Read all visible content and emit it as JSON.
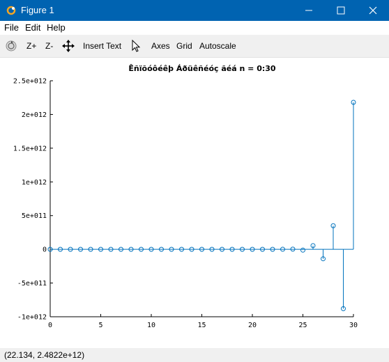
{
  "window": {
    "title": "Figure 1",
    "accent": "#0063b1"
  },
  "menu": {
    "items": [
      "File",
      "Edit",
      "Help"
    ]
  },
  "toolbar": {
    "zoom_in": "Z+",
    "zoom_out": "Z-",
    "insert_text": "Insert Text",
    "axes": "Axes",
    "grid": "Grid",
    "autoscale": "Autoscale"
  },
  "status": {
    "coords": "(22.134, 2.4822e+12)"
  },
  "chart_data": {
    "type": "stem",
    "title": "Êñïõóôéêþ Áðüêñéóç ãéá n = 0:30",
    "xlabel": "",
    "ylabel": "",
    "xlim": [
      0,
      30
    ],
    "ylim": [
      -1000000000000.0,
      2500000000000.0
    ],
    "x_ticks": [
      0,
      5,
      10,
      15,
      20,
      25,
      30
    ],
    "y_ticks": [
      -1000000000000.0,
      -500000000000.0,
      0,
      500000000000.0,
      1000000000000.0,
      1500000000000.0,
      2000000000000.0,
      2500000000000.0
    ],
    "x_tick_labels": [
      "0",
      "5",
      "10",
      "15",
      "20",
      "25",
      "30"
    ],
    "y_tick_labels": [
      "-1e+012",
      "-5e+011",
      "0",
      "5e+011",
      "1e+012",
      "1.5e+012",
      "2e+012",
      "2.5e+012"
    ],
    "color": "#0072bd",
    "series": [
      {
        "x": [
          0,
          1,
          2,
          3,
          4,
          5,
          6,
          7,
          8,
          9,
          10,
          11,
          12,
          13,
          14,
          15,
          16,
          17,
          18,
          19,
          20,
          21,
          22,
          23,
          24,
          25,
          26,
          27,
          28,
          29,
          30
        ],
        "values": [
          0,
          0,
          0,
          0,
          0,
          0,
          0,
          0,
          0,
          0,
          0,
          0,
          0,
          0,
          0,
          0,
          0,
          0,
          0,
          0,
          0,
          0,
          0,
          1000000000.0,
          3000000000.0,
          -12000000000.0,
          55000000000.0,
          -140000000000.0,
          350000000000.0,
          -880000000000.0,
          2180000000000.0
        ]
      }
    ]
  }
}
